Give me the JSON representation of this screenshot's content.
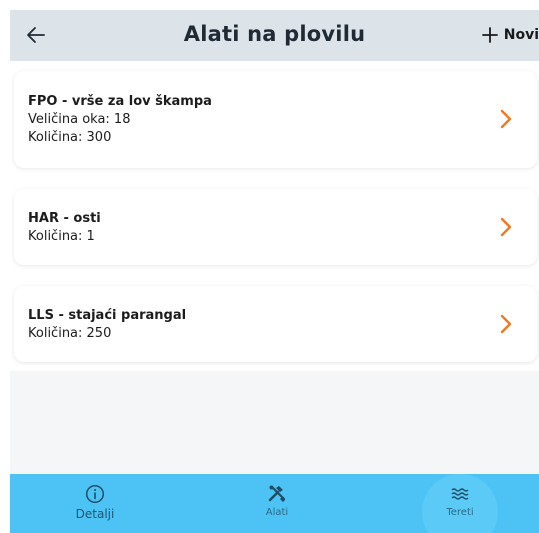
{
  "header": {
    "title": "Alati na plovilu",
    "new_label": "Novi",
    "back_icon": "arrow-left-icon",
    "plus_icon": "plus-icon"
  },
  "items": [
    {
      "title": "FPO - vrše za lov škampa",
      "lines": [
        "Veličina oka: 18",
        "Količina: 300"
      ]
    },
    {
      "title": "HAR - osti",
      "lines": [
        "Količina: 1"
      ]
    },
    {
      "title": "LLS - stajaći parangal",
      "lines": [
        "Količina: 250"
      ]
    }
  ],
  "nav": {
    "items": [
      {
        "label": "Detalji",
        "icon": "info-circle-icon"
      },
      {
        "label": "Alati",
        "icon": "tools-icon"
      },
      {
        "label": "Tereti",
        "icon": "waves-icon"
      }
    ]
  },
  "colors": {
    "header_bg": "#dce4ea",
    "accent_orange": "#ee7a22",
    "nav_bg": "#4dc3f5"
  }
}
